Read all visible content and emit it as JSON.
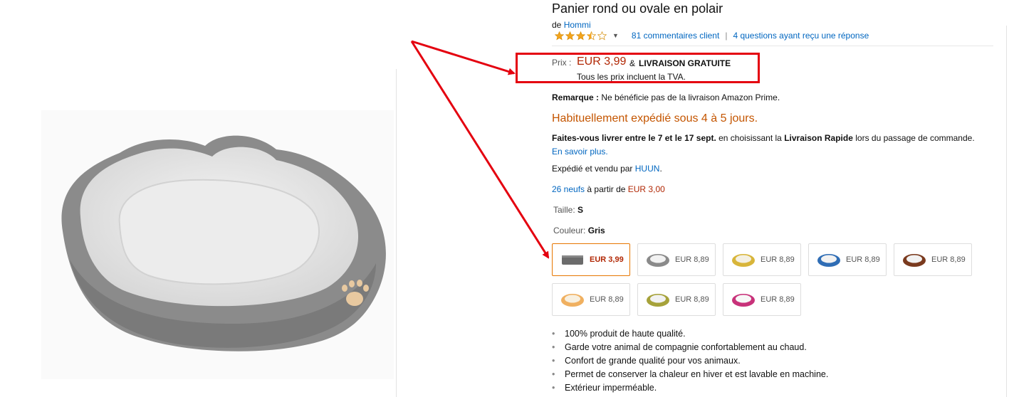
{
  "product": {
    "title": "Panier rond ou ovale en polair",
    "by_prefix": "de",
    "brand": "Hommi",
    "rating_stars": 3.5,
    "reviews_link": "81 commentaires client",
    "separator": "|",
    "questions_link": "4 questions ayant reçu une réponse"
  },
  "price": {
    "label": "Prix :",
    "value": "EUR 3,99",
    "amp": "&",
    "shipping": "LIVRAISON GRATUITE",
    "vat_note": "Tous les prix incluent la TVA."
  },
  "remark": {
    "label": "Remarque :",
    "text": "Ne bénéficie pas de la livraison Amazon Prime."
  },
  "availability": "Habituellement expédié sous 4 à 5 jours.",
  "delivery": {
    "bold1": "Faites-vous livrer entre le 7 et le 17 sept.",
    "text1": "en choisissant la",
    "bold2": "Livraison Rapide",
    "text2": "lors du passage de commande.",
    "link": "En savoir plus."
  },
  "seller": {
    "prefix": "Expédié et vendu par",
    "name": "HUUN",
    "suffix": "."
  },
  "offers": {
    "link": "26 neufs",
    "text": "à partir de",
    "price": "EUR 3,00"
  },
  "size": {
    "label": "Taille:",
    "value": "S"
  },
  "color": {
    "label": "Couleur:",
    "value": "Gris"
  },
  "swatches": [
    {
      "price": "EUR 3,99",
      "color": "#6b6b6b",
      "inner": "#6b6b6b",
      "selected": true
    },
    {
      "price": "EUR 8,89",
      "color": "#8a8a8a",
      "inner": "#f2f2f2"
    },
    {
      "price": "EUR 8,89",
      "color": "#d8b53a",
      "inner": "#f4f0e2"
    },
    {
      "price": "EUR 8,89",
      "color": "#2f6db5",
      "inner": "#f2f2f2"
    },
    {
      "price": "EUR 8,89",
      "color": "#7a3a1e",
      "inner": "#f2f2f2"
    },
    {
      "price": "EUR 8,89",
      "color": "#f0b060",
      "inner": "#f8f0e0"
    },
    {
      "price": "EUR 8,89",
      "color": "#a6a23a",
      "inner": "#f2f2f2"
    },
    {
      "price": "EUR 8,89",
      "color": "#c8327a",
      "inner": "#f7f7f7"
    }
  ],
  "bullets": [
    "100% produit de haute qualité.",
    "Garde votre animal de compagnie confortablement au chaud.",
    "Confort de grande qualité pour vos animaux.",
    "Permet de conserver la chaleur en hiver et est lavable en machine.",
    "Extérieur imperméable."
  ],
  "colors": {
    "accent_red": "#b12704",
    "availability": "#c45500",
    "link": "#0066c0",
    "annotation": "#e4000f",
    "selected_border": "#e77600"
  }
}
